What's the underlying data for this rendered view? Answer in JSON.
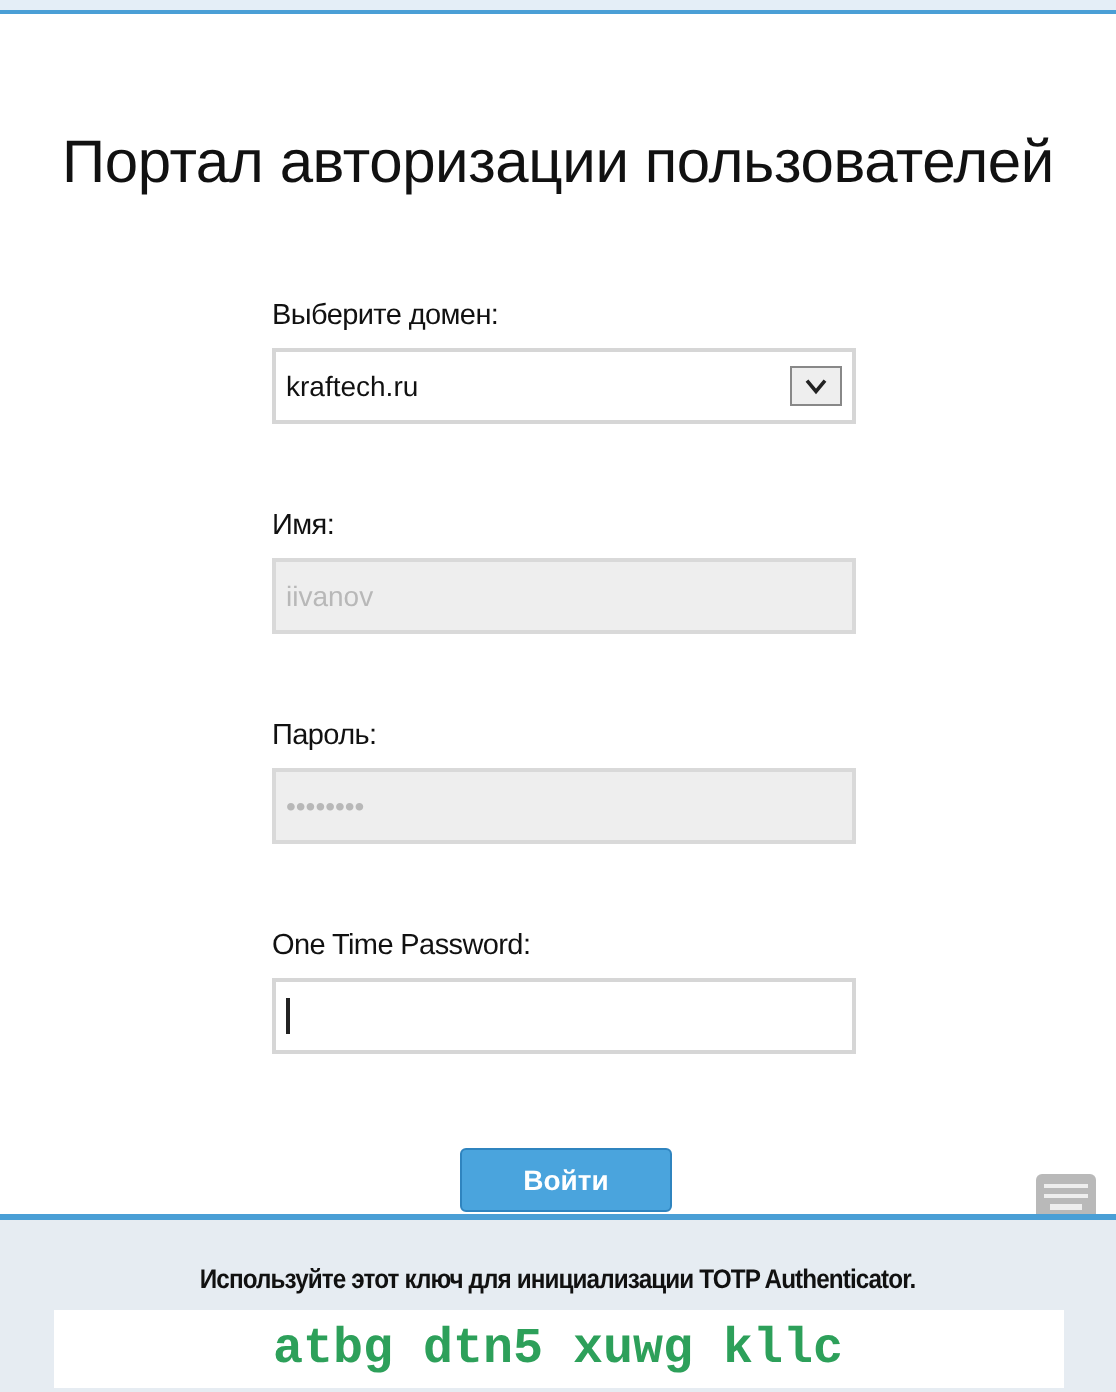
{
  "title": "Портал авторизации пользователей",
  "fields": [
    {
      "kind": "select",
      "label": "Выберите домен:",
      "value": "kraftech.ru",
      "disabled": false,
      "focused": false
    },
    {
      "kind": "text",
      "label": "Имя:",
      "value": "iivanov",
      "disabled": true,
      "focused": false
    },
    {
      "kind": "text",
      "label": "Пароль:",
      "value": "••••••••",
      "disabled": true,
      "focused": false
    },
    {
      "kind": "text",
      "label": "One Time Password:",
      "disabled": false,
      "focused": true
    }
  ],
  "submit": "Войти",
  "footer": {
    "hint": "Используйте этот ключ для инициализации TOTP Authenticator.",
    "key": "atbg dtn5 xuwg kllc"
  }
}
